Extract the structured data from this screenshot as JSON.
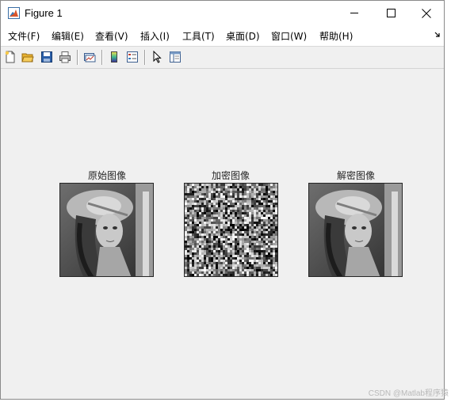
{
  "window": {
    "title": "Figure 1",
    "controls": {
      "minimize": "minimize",
      "maximize": "maximize",
      "close": "close"
    }
  },
  "menu": {
    "items": [
      "文件(F)",
      "编辑(E)",
      "查看(V)",
      "插入(I)",
      "工具(T)",
      "桌面(D)",
      "窗口(W)",
      "帮助(H)"
    ],
    "corner_icon": "dock-arrow-icon"
  },
  "toolbar": {
    "buttons": [
      {
        "icon": "new-figure-icon"
      },
      {
        "icon": "open-file-icon"
      },
      {
        "icon": "save-icon"
      },
      {
        "icon": "print-icon"
      },
      {
        "icon": "link-plot-icon"
      },
      {
        "icon": "insert-colorbar-icon"
      },
      {
        "icon": "insert-legend-icon"
      },
      {
        "icon": "edit-plot-arrow-icon"
      },
      {
        "icon": "property-inspector-icon"
      }
    ]
  },
  "figure": {
    "panels": [
      {
        "title": "原始图像",
        "kind": "grayscale-portrait"
      },
      {
        "title": "加密图像",
        "kind": "noise"
      },
      {
        "title": "解密图像",
        "kind": "grayscale-portrait"
      }
    ]
  },
  "watermark": "CSDN @Matlab程序猿",
  "colors": {
    "figure_background": "#f0f0f0",
    "title_text": "#262626",
    "toolbar_background": "#f0f0f0"
  }
}
